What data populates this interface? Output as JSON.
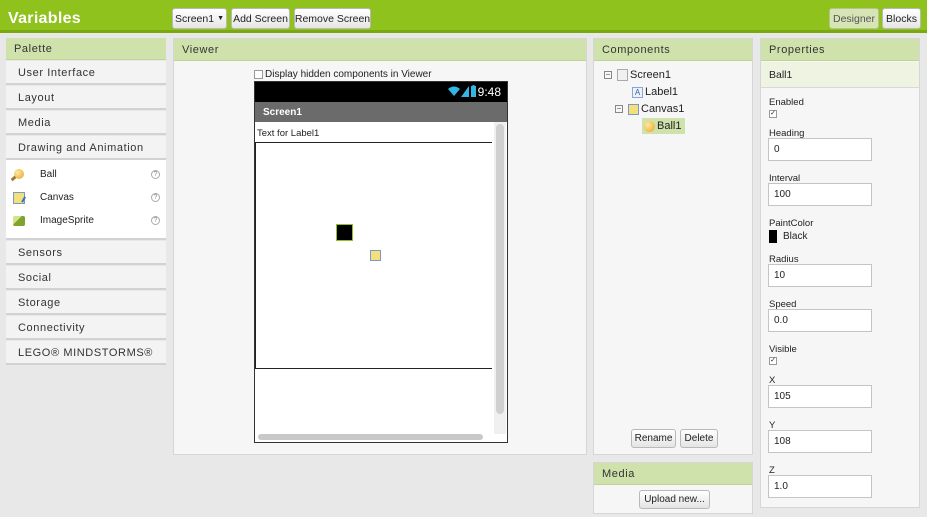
{
  "app": {
    "title": "Variables"
  },
  "toolbar": {
    "screen_select": "Screen1",
    "add_screen": "Add Screen",
    "remove_screen": "Remove Screen",
    "designer": "Designer",
    "blocks": "Blocks"
  },
  "palette": {
    "title": "Palette",
    "categories_top": [
      "User Interface",
      "Layout",
      "Media",
      "Drawing and Animation"
    ],
    "open_items": [
      {
        "label": "Ball",
        "icon": "ball-icon"
      },
      {
        "label": "Canvas",
        "icon": "canvas-icon"
      },
      {
        "label": "ImageSprite",
        "icon": "image-sprite-icon"
      }
    ],
    "help_glyph": "?",
    "categories_bottom": [
      "Sensors",
      "Social",
      "Storage",
      "Connectivity",
      "LEGO® MINDSTORMS®"
    ]
  },
  "viewer": {
    "title": "Viewer",
    "hidden_checkbox_label": "Display hidden components in Viewer",
    "status_time": "9:48",
    "screen_title": "Screen1",
    "label_text": "Text for Label1"
  },
  "components": {
    "title": "Components",
    "tree": {
      "screen": "Screen1",
      "label": "Label1",
      "canvas": "Canvas1",
      "ball": "Ball1"
    },
    "toggle_glyph": "⊟",
    "rename": "Rename",
    "delete": "Delete"
  },
  "media": {
    "title": "Media",
    "upload": "Upload new..."
  },
  "properties": {
    "title": "Properties",
    "component": "Ball1",
    "enabled_label": "Enabled",
    "heading_label": "Heading",
    "heading_value": "0",
    "interval_label": "Interval",
    "interval_value": "100",
    "paint_color_label": "PaintColor",
    "paint_color_value": "Black",
    "radius_label": "Radius",
    "radius_value": "10",
    "speed_label": "Speed",
    "speed_value": "0.0",
    "visible_label": "Visible",
    "x_label": "X",
    "x_value": "105",
    "y_label": "Y",
    "y_value": "108",
    "z_label": "Z",
    "z_value": "1.0",
    "check_glyph": "✓"
  },
  "colors": {
    "brand_green": "#8fc21c",
    "panel_header": "#d0e2ab",
    "paint_color": "#000000"
  }
}
